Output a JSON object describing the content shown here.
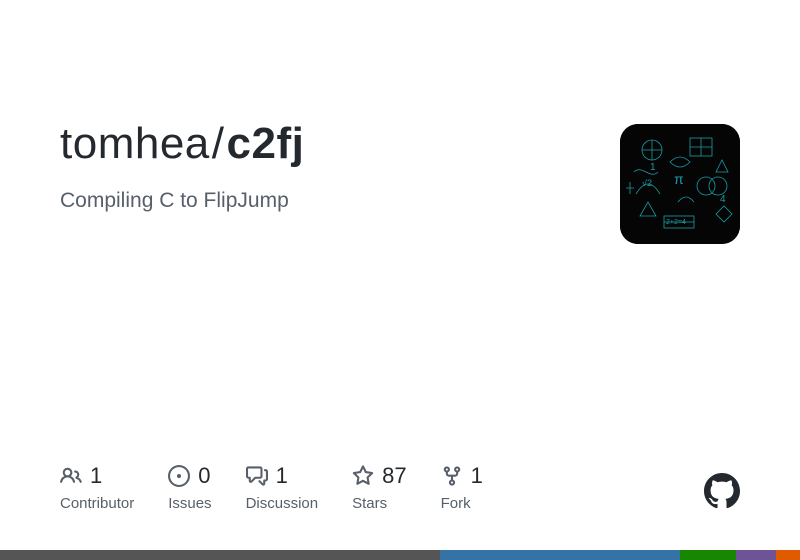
{
  "repo": {
    "owner": "tomhea",
    "name": "c2fj",
    "description": "Compiling C to FlipJump"
  },
  "stats": [
    {
      "icon": "people-icon",
      "count": "1",
      "label": "Contributor"
    },
    {
      "icon": "issue-icon",
      "count": "0",
      "label": "Issues"
    },
    {
      "icon": "discussion-icon",
      "count": "1",
      "label": "Discussion"
    },
    {
      "icon": "star-icon",
      "count": "87",
      "label": "Stars"
    },
    {
      "icon": "fork-icon",
      "count": "1",
      "label": "Fork"
    }
  ],
  "language_bar": [
    {
      "color": "#555555",
      "percent": 55
    },
    {
      "color": "#3572A5",
      "percent": 30
    },
    {
      "color": "#178600",
      "percent": 7
    },
    {
      "color": "#6e5494",
      "percent": 5
    },
    {
      "color": "#e05a00",
      "percent": 3
    }
  ]
}
